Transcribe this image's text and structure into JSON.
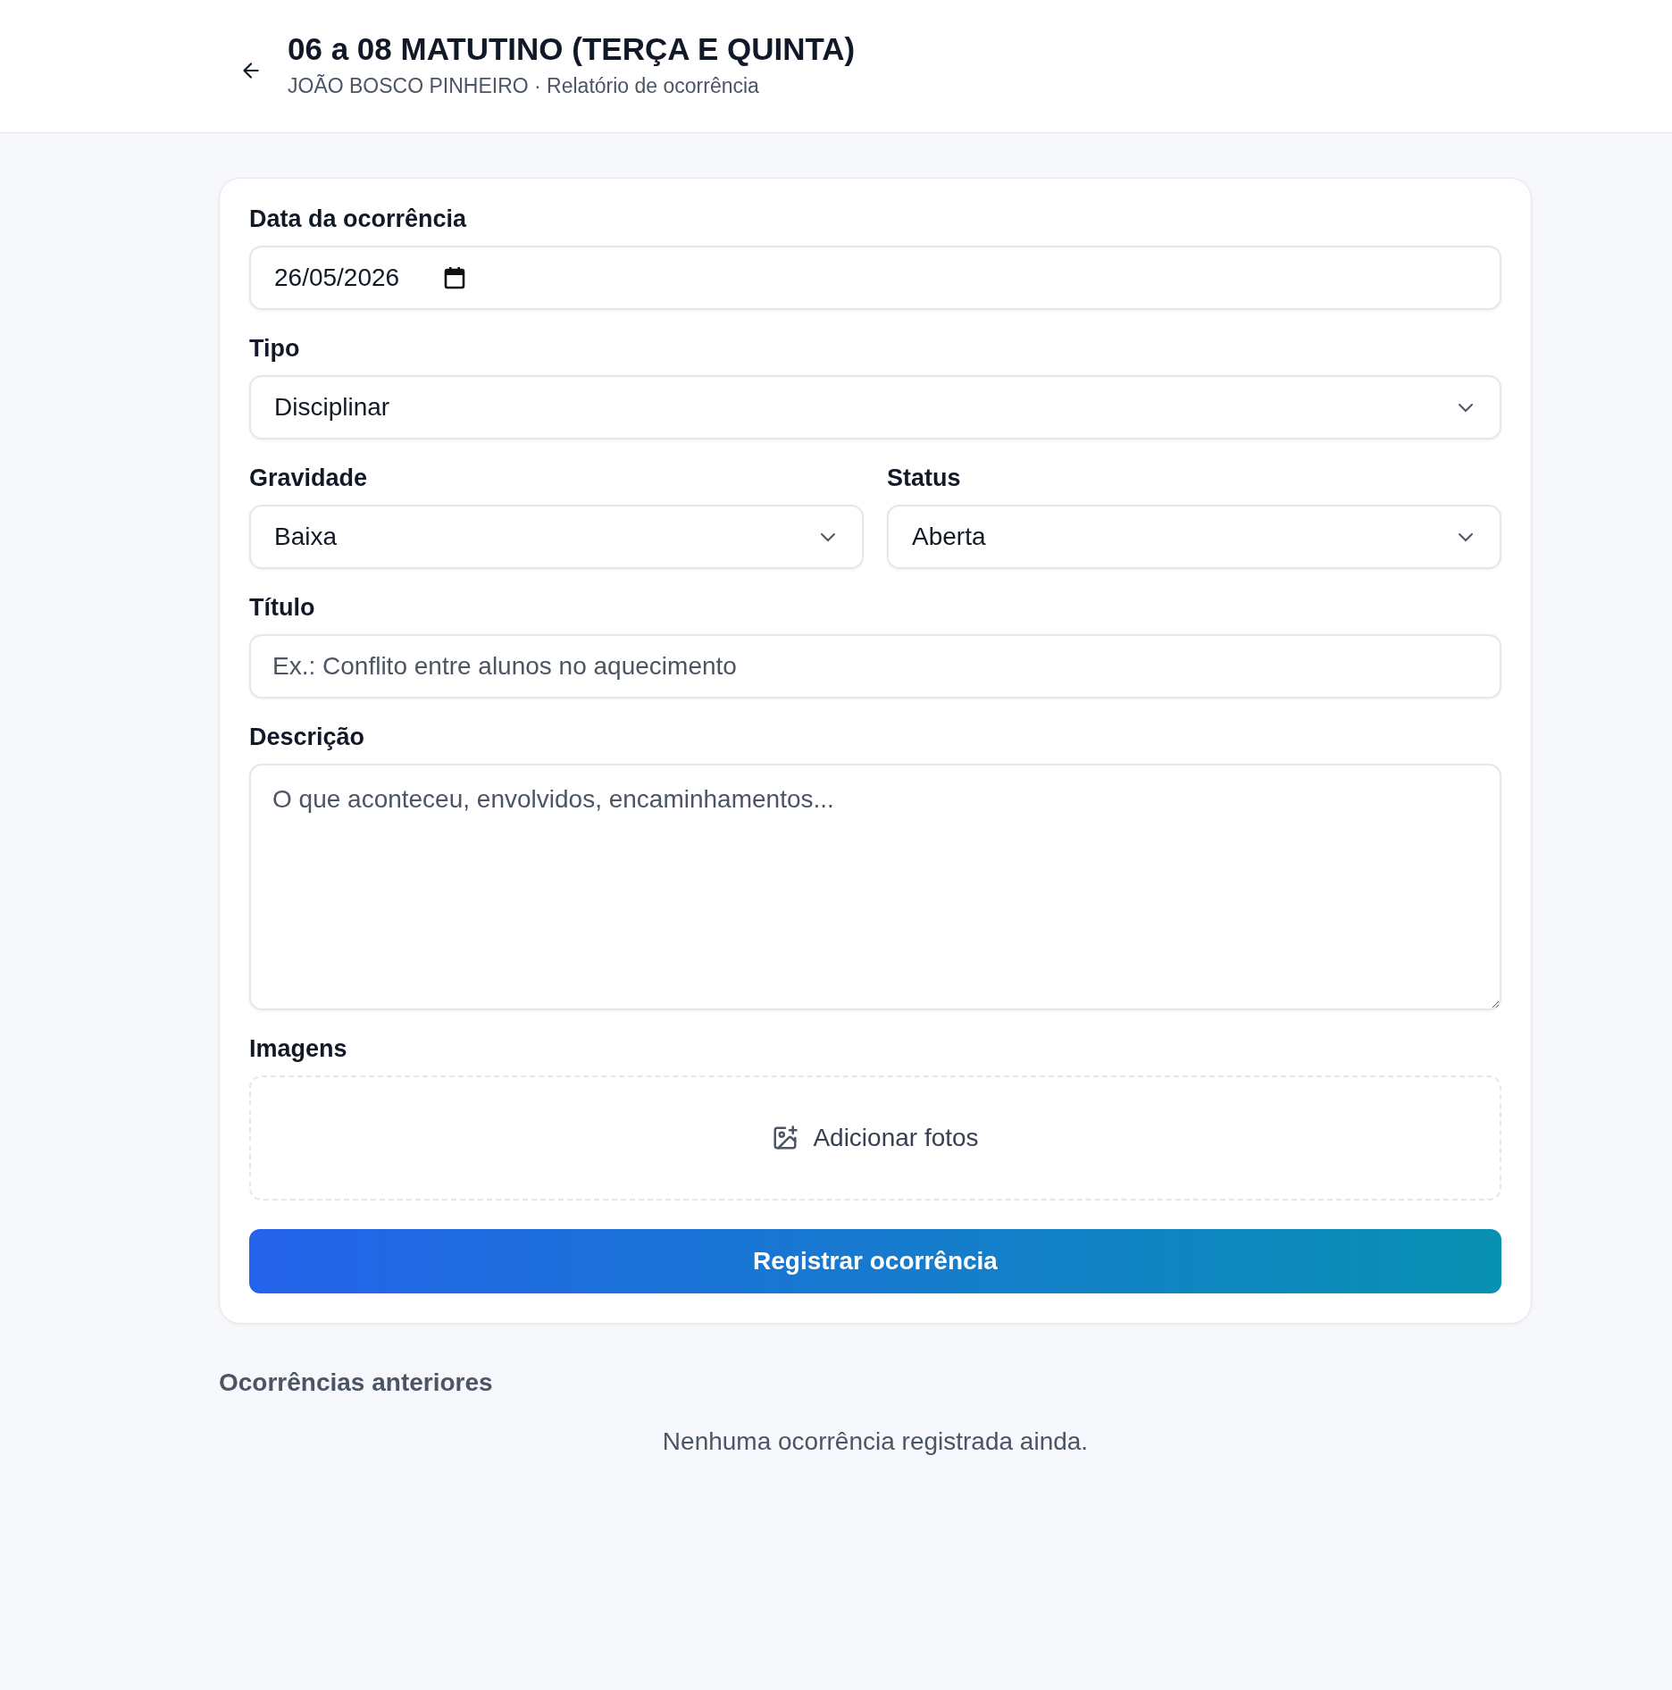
{
  "header": {
    "title": "06 a 08 MATUTINO (TERÇA E QUINTA)",
    "subtitle": "JOÃO BOSCO PINHEIRO · Relatório de ocorrência"
  },
  "form": {
    "rows": [
      [
        {
          "kind": "date",
          "label": "Data da ocorrência",
          "value": "26/05/2026"
        }
      ],
      [
        {
          "kind": "select",
          "label": "Tipo",
          "value": "Disciplinar"
        }
      ],
      [
        {
          "kind": "select",
          "label": "Gravidade",
          "value": "Baixa"
        },
        {
          "kind": "select",
          "label": "Status",
          "value": "Aberta"
        }
      ],
      [
        {
          "kind": "text",
          "label": "Título",
          "placeholder": "Ex.: Conflito entre alunos no aquecimento"
        }
      ],
      [
        {
          "kind": "textarea",
          "label": "Descrição",
          "placeholder": "O que aconteceu, envolvidos, encaminhamentos..."
        }
      ],
      [
        {
          "kind": "upload",
          "label": "Imagens",
          "action": "Adicionar fotos"
        }
      ]
    ],
    "submit": "Registrar ocorrência"
  },
  "history": {
    "heading": "Ocorrências anteriores",
    "empty": "Nenhuma ocorrência registrada ainda."
  }
}
